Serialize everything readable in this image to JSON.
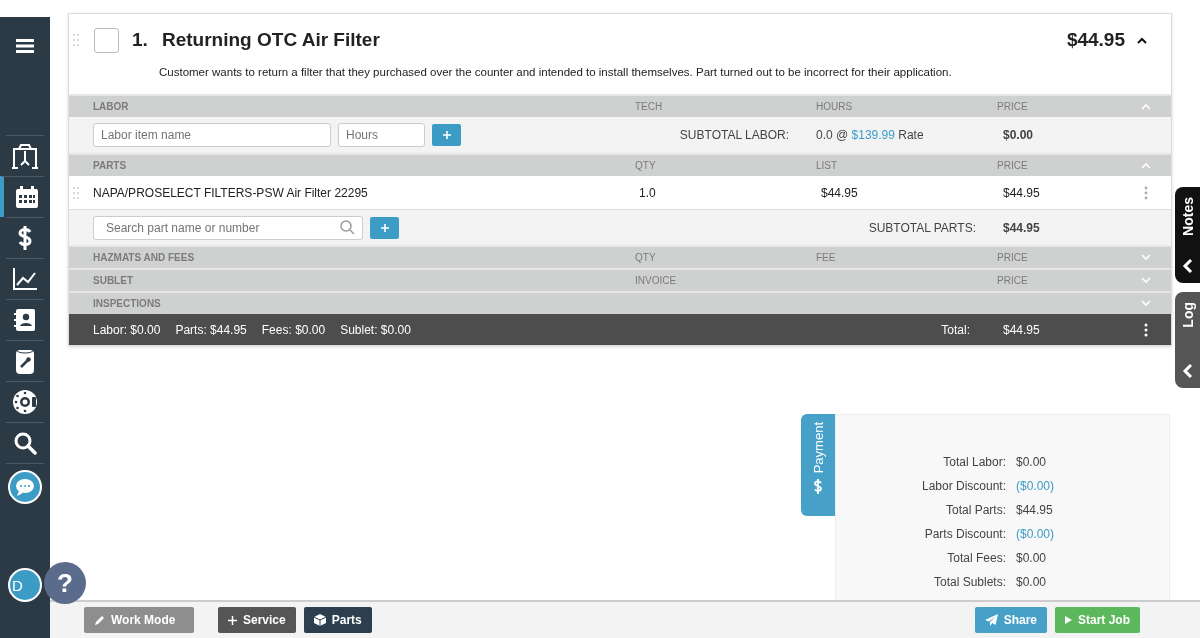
{
  "sidebar": {
    "items": [
      {
        "kind": "menu",
        "selected": false
      },
      {
        "kind": "lift",
        "selected": false
      },
      {
        "kind": "calendar",
        "selected": true
      },
      {
        "kind": "dollar",
        "selected": false
      },
      {
        "kind": "chart",
        "selected": false
      },
      {
        "kind": "contacts",
        "selected": false
      },
      {
        "kind": "can",
        "selected": false
      },
      {
        "kind": "tire",
        "selected": false
      },
      {
        "kind": "search",
        "selected": false
      },
      {
        "kind": "chat",
        "selected": false
      }
    ],
    "avatar": "D",
    "help": "?"
  },
  "job": {
    "number": "1.",
    "title": "Returning OTC Air Filter",
    "total": "$44.95",
    "checked": false,
    "expanded": true,
    "description": "Customer wants to return a filter that they purchased over the counter and intended to install themselves. Part turned out to be incorrect for their application."
  },
  "sections": [
    {
      "kind": "labor",
      "title": "LABOR",
      "second_column": "TECH",
      "third_column": "HOURS",
      "price_column": "PRICE",
      "expanded": true,
      "name_placeholder": "Labor item name",
      "hours_placeholder": "Hours",
      "subtotal_label": "SUBTOTAL LABOR:",
      "subtotal_hours": "0.0 @",
      "rate": "$139.99",
      "rate_suffix": "Rate",
      "subtotal_value": "$0.00"
    },
    {
      "kind": "parts",
      "title": "PARTS",
      "second_column": "QTY",
      "third_column": "LIST",
      "price_column": "PRICE",
      "expanded": true,
      "items": [
        {
          "name": "NAPA/PROSELECT FILTERS-PSW Air Filter 22295",
          "qty": "1.0",
          "list": "$44.95",
          "price": "$44.95"
        }
      ],
      "search_placeholder": "Search part name or number",
      "subtotal_label": "SUBTOTAL PARTS:",
      "subtotal_value": "$44.95"
    },
    {
      "title": "HAZMATS AND FEES",
      "second_column": "QTY",
      "third_column": "FEE",
      "price_column": "PRICE",
      "expanded": false
    },
    {
      "title": "SUBLET",
      "second_column": "INVOICE",
      "price_column": "PRICE",
      "expanded": false
    },
    {
      "title": "INSPECTIONS",
      "expanded": false
    }
  ],
  "summary": {
    "items": [
      "Labor: $0.00",
      "Parts: $44.95",
      "Fees: $0.00",
      "Sublet: $0.00"
    ],
    "total_label": "Total:",
    "total_value": "$44.95"
  },
  "side_tabs": [
    {
      "label": "Notes",
      "kind": "dark"
    },
    {
      "label": "Log",
      "kind": "grey"
    }
  ],
  "payment": {
    "tab": "Payment",
    "rows": [
      {
        "label": "Total Labor:",
        "value": "$0.00",
        "kind": "amount"
      },
      {
        "label": "Labor Discount:",
        "value": "($0.00)",
        "kind": "discount"
      },
      {
        "label": "Total Parts:",
        "value": "$44.95",
        "kind": "amount"
      },
      {
        "label": "Parts Discount:",
        "value": "($0.00)",
        "kind": "discount"
      },
      {
        "label": "Total Fees:",
        "value": "$0.00",
        "kind": "amount"
      },
      {
        "label": "Total Sublets:",
        "value": "$0.00",
        "kind": "amount"
      }
    ]
  },
  "bottom_bar": {
    "left": [
      {
        "label": "Work Mode",
        "kind": "work",
        "disabled": true
      },
      {
        "label": "Service",
        "kind": "service",
        "disabled": false
      },
      {
        "label": "Parts",
        "kind": "parts",
        "disabled": false
      }
    ],
    "right": [
      {
        "label": "Share",
        "kind": "share",
        "disabled": false
      },
      {
        "label": "Start Job",
        "kind": "start",
        "disabled": false
      }
    ]
  }
}
